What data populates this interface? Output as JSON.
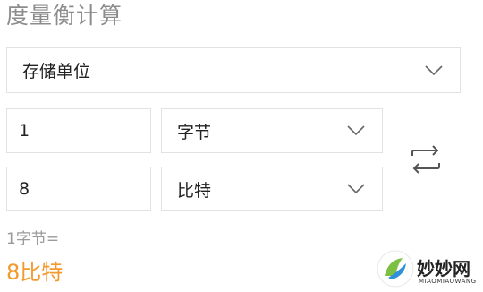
{
  "title": "度量衡计算",
  "unit_type": {
    "selected": "存储单位"
  },
  "from": {
    "value": "1",
    "unit": "字节"
  },
  "to": {
    "value": "8",
    "unit": "比特"
  },
  "result": {
    "formula": "1字节=",
    "value": "8比特"
  },
  "watermark": {
    "text": "妙妙网",
    "subtext": "MIAOMIAOWANG"
  },
  "colors": {
    "result_accent": "#f39a2f",
    "logo_green": "#7cc043",
    "logo_blue": "#2f8fd8"
  },
  "icons": {
    "dropdown": "chevron-down-icon",
    "swap": "swap-arrows-icon"
  }
}
